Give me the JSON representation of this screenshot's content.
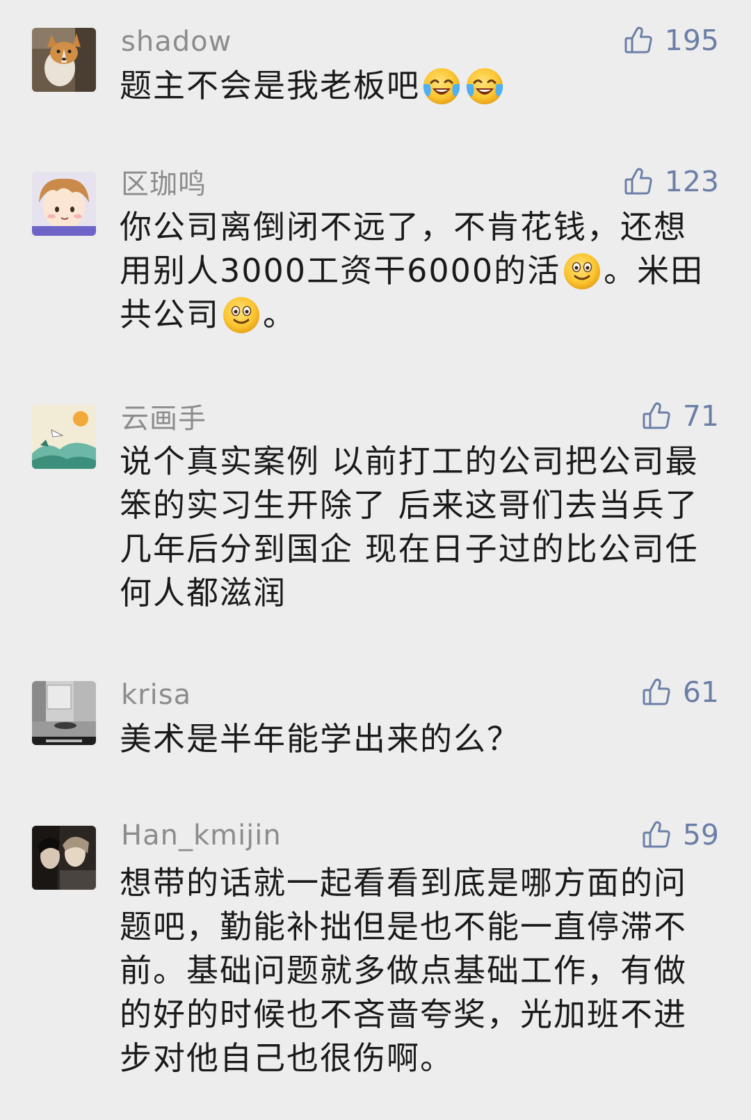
{
  "comments": [
    {
      "username": "shadow",
      "likes": "195",
      "text_before": "题主不会是我老板吧",
      "emoji": [
        "crying-laughing-emoji",
        "crying-laughing-emoji"
      ]
    },
    {
      "username": "区珈鸣",
      "likes": "123",
      "text_part1": "你公司离倒闭不远了，不肯花钱，还想用别人3000工资干6000的活",
      "text_part2": "。米田共公司",
      "text_part3": "。",
      "emoji": [
        "smile-emoji",
        "smile-emoji"
      ]
    },
    {
      "username": "云画手",
      "likes": "71",
      "text": "说个真实案例 以前打工的公司把公司最笨的实习生开除了 后来这哥们去当兵了 几年后分到国企 现在日子过的比公司任何人都滋润"
    },
    {
      "username": "krisa",
      "likes": "61",
      "text": "美术是半年能学出来的么？"
    },
    {
      "username": "Han_kmijin",
      "likes": "59",
      "text": "想带的话就一起看看到底是哪方面的问题吧，勤能补拙但是也不能一直停滞不前。基础问题就多做点基础工作，有做的好的时候也不吝啬夸奖，光加班不进步对他自己也很伤啊。"
    }
  ],
  "colors": {
    "background": "#ededed",
    "username": "#8c8c8c",
    "likes": "#6b7fa6",
    "text": "#1a1a1a"
  },
  "icons": {
    "like": "thumbs-up-icon"
  }
}
